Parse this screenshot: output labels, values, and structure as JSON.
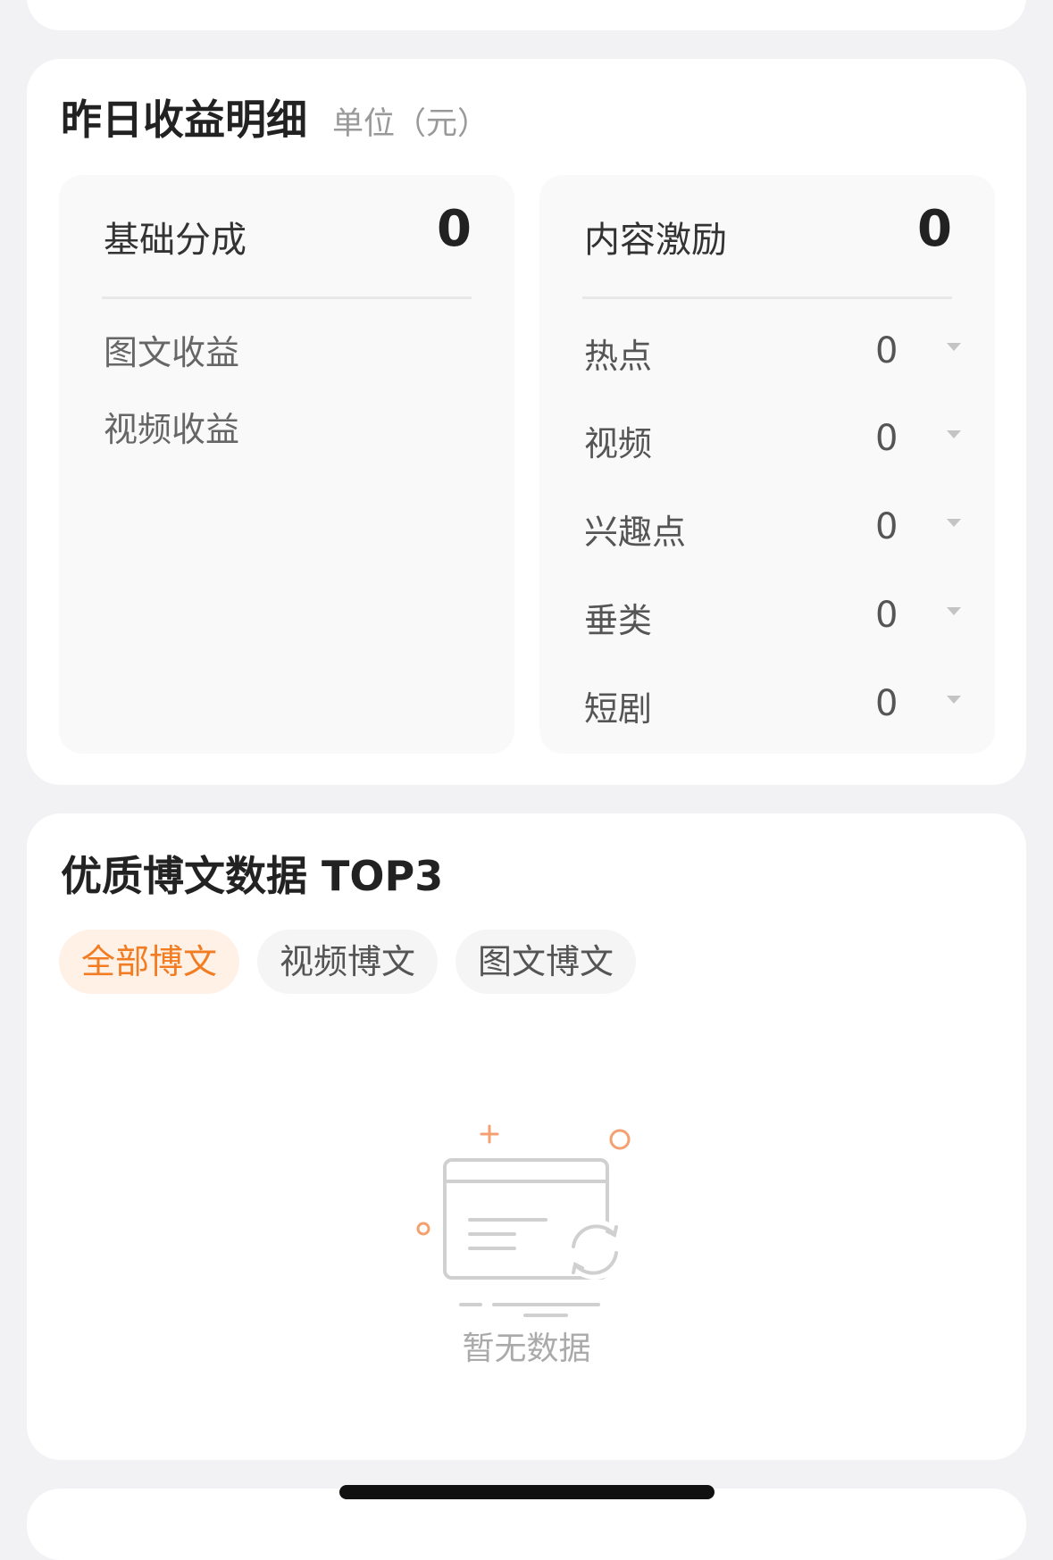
{
  "earnings": {
    "title": "昨日收益明细",
    "unit": "单位（元）",
    "base": {
      "label": "基础分成",
      "total": "0",
      "items": [
        "图文收益",
        "视频收益"
      ]
    },
    "incentive": {
      "label": "内容激励",
      "total": "0",
      "items": [
        {
          "label": "热点",
          "value": "0"
        },
        {
          "label": "视频",
          "value": "0"
        },
        {
          "label": "兴趣点",
          "value": "0"
        },
        {
          "label": "垂类",
          "value": "0"
        },
        {
          "label": "短剧",
          "value": "0"
        }
      ]
    }
  },
  "top3": {
    "title": "优质博文数据 TOP3",
    "tabs": [
      "全部博文",
      "视频博文",
      "图文博文"
    ],
    "active_tab": "全部博文",
    "empty_text": "暂无数据"
  },
  "colors": {
    "accent": "#f27c22",
    "accent_bg": "#fff1e6",
    "background": "#f2f2f5"
  }
}
